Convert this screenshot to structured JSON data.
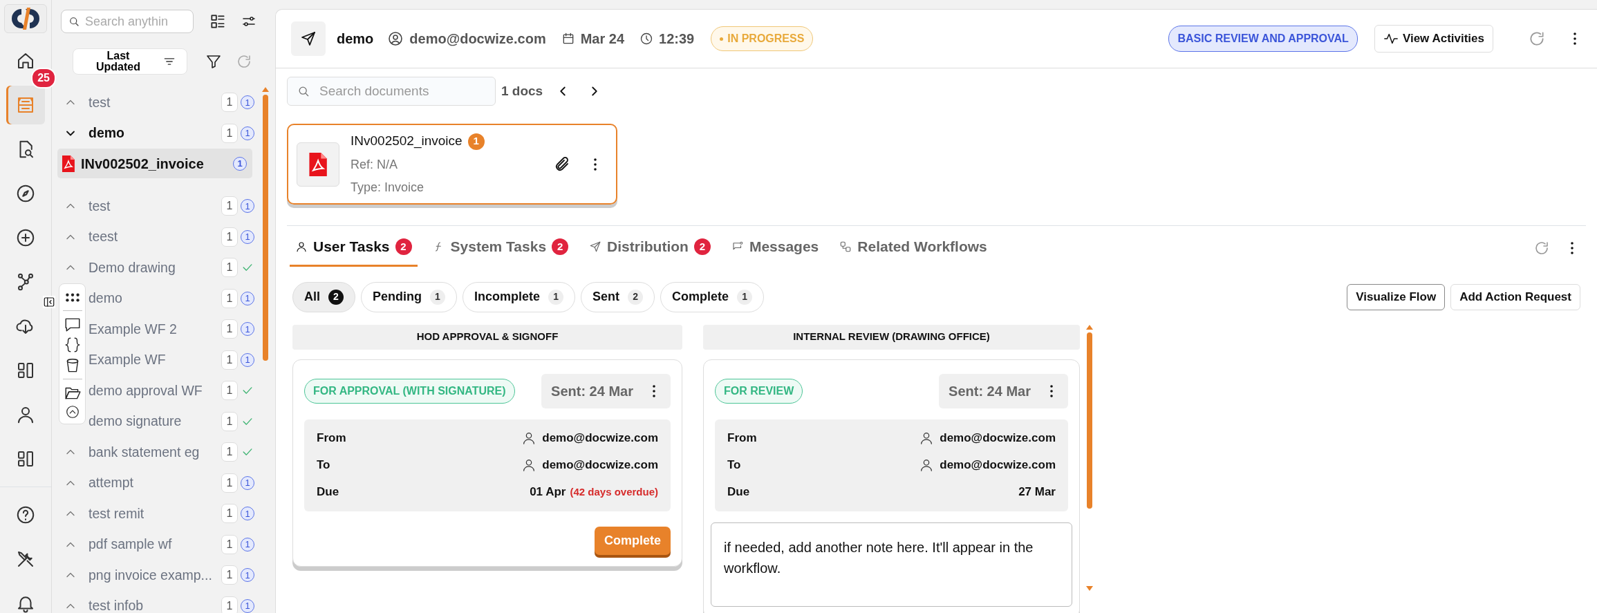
{
  "rail": {
    "items": [
      {
        "selected": false
      },
      {
        "selected": true,
        "badge": "25"
      },
      {
        "selected": false
      },
      {
        "selected": false
      },
      {
        "selected": false
      },
      {
        "selected": false
      },
      {
        "selected": false
      },
      {
        "selected": false
      },
      {
        "selected": false
      },
      {
        "selected": false
      }
    ],
    "bottom_items": [
      {
        "selected": false
      },
      {
        "selected": false
      },
      {
        "selected": false
      }
    ]
  },
  "sidebar": {
    "search": {
      "placeholder": "Search anythin"
    },
    "sort": {
      "label": "Last Updated"
    },
    "items": [
      {
        "name": "test",
        "expanded": false,
        "count": "1",
        "done": false,
        "pending": "1"
      },
      {
        "name": "demo",
        "expanded": true,
        "count": "1",
        "done": false,
        "pending": "1",
        "children": [
          {
            "name": "INv002502_invoice",
            "selected": true,
            "pending": "1"
          }
        ]
      },
      {
        "name": "test",
        "expanded": false,
        "count": "1",
        "done": false,
        "pending": "1"
      },
      {
        "name": "teest",
        "expanded": false,
        "count": "1",
        "done": false,
        "pending": "1"
      },
      {
        "name": "Demo drawing",
        "expanded": false,
        "count": "1",
        "done": true
      },
      {
        "name": "demo",
        "count": "1",
        "done": false,
        "pending": "1"
      },
      {
        "name": "Example WF 2",
        "count": "1",
        "done": false,
        "pending": "1"
      },
      {
        "name": "Example WF",
        "count": "1",
        "done": false,
        "pending": "1"
      },
      {
        "name": "demo approval WF",
        "count": "1",
        "done": true
      },
      {
        "name": "demo signature",
        "count": "1",
        "done": true
      },
      {
        "name": "bank statement eg",
        "expanded": false,
        "count": "1",
        "done": true
      },
      {
        "name": "attempt",
        "expanded": false,
        "count": "1",
        "done": false,
        "pending": "1"
      },
      {
        "name": "test remit",
        "expanded": false,
        "count": "1",
        "done": false,
        "pending": "1"
      },
      {
        "name": "pdf sample wf",
        "expanded": false,
        "count": "1",
        "done": false,
        "pending": "1"
      },
      {
        "name": "png invoice examp...",
        "expanded": false,
        "count": "1",
        "done": false,
        "pending": "1"
      },
      {
        "name": "test infob",
        "expanded": false,
        "count": "1",
        "done": false,
        "pending": "1"
      }
    ]
  },
  "header": {
    "title": "demo",
    "user": "demo@docwize.com",
    "date": "Mar 24",
    "time": "12:39",
    "status": "IN PROGRESS",
    "workflow": "BASIC REVIEW AND APPROVAL",
    "activities_button": "View Activities"
  },
  "documents": {
    "search": {
      "placeholder": "Search documents"
    },
    "count": "1 docs",
    "items": [
      {
        "name": "INv002502_invoice",
        "badge": "1",
        "ref": "Ref: N/A",
        "type": "Type: Invoice",
        "selected": true
      }
    ]
  },
  "tabs": [
    {
      "label": "User Tasks",
      "badge": "2",
      "selected": true
    },
    {
      "label": "System Tasks",
      "badge": "2",
      "selected": false
    },
    {
      "label": "Distribution",
      "badge": "2",
      "selected": false
    },
    {
      "label": "Messages",
      "selected": false
    },
    {
      "label": "Related Workflows",
      "selected": false
    }
  ],
  "filters": [
    {
      "label": "All",
      "count": "2",
      "selected": true
    },
    {
      "label": "Pending",
      "count": "1",
      "selected": false
    },
    {
      "label": "Incomplete",
      "count": "1",
      "selected": false
    },
    {
      "label": "Sent",
      "count": "2",
      "selected": false
    },
    {
      "label": "Complete",
      "count": "1",
      "selected": false
    }
  ],
  "actions": [
    "Visualize Flow",
    "Add Action Request"
  ],
  "columns": [
    {
      "title": "HOD APPROVAL & SIGNOFF",
      "tasks": [
        {
          "tag": "FOR APPROVAL (WITH SIGNATURE)",
          "sent": "Sent: 24 Mar",
          "details": [
            {
              "kind": "person",
              "label": "From",
              "value": "demo@docwize.com"
            },
            {
              "kind": "person",
              "label": "To",
              "value": "demo@docwize.com"
            },
            {
              "kind": "date",
              "label": "Due",
              "value": "01 Apr",
              "note": "(42 days overdue)"
            }
          ],
          "action": "Complete"
        }
      ]
    },
    {
      "title": "INTERNAL REVIEW (DRAWING OFFICE)",
      "tasks": [
        {
          "tag": "FOR REVIEW",
          "sent": "Sent: 24 Mar",
          "details": [
            {
              "kind": "person",
              "label": "From",
              "value": "demo@docwize.com"
            },
            {
              "kind": "person",
              "label": "To",
              "value": "demo@docwize.com"
            },
            {
              "kind": "date",
              "label": "Due",
              "value": "27 Mar"
            }
          ],
          "note": "if needed, add another note here. It'll appear in the workflow."
        }
      ]
    }
  ]
}
